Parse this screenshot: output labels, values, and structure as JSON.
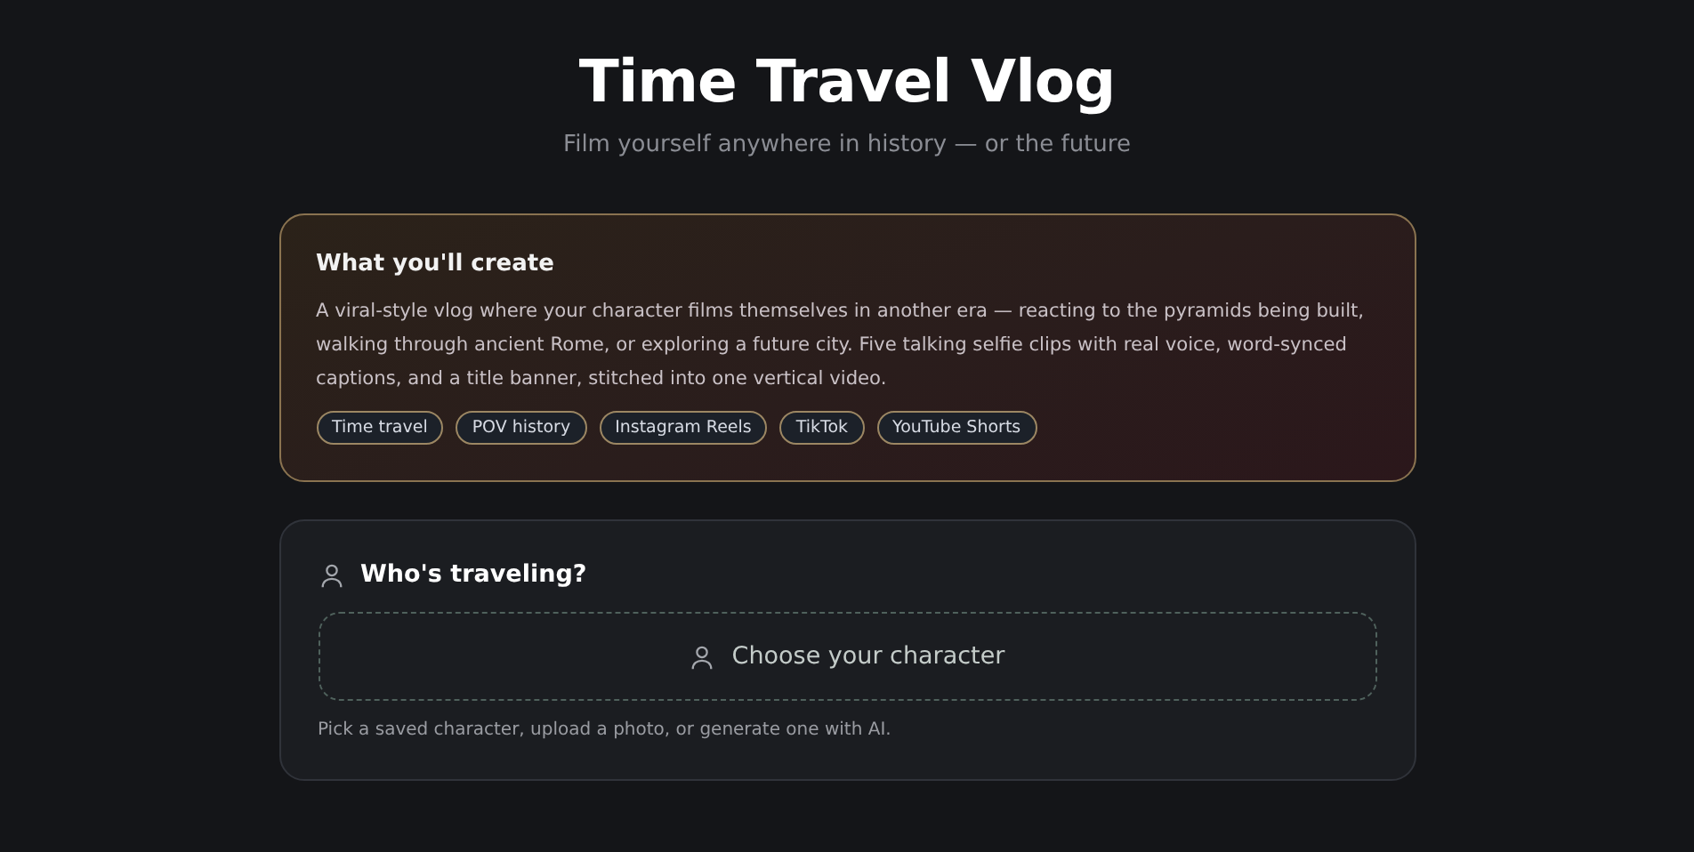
{
  "header": {
    "title": "Time Travel Vlog",
    "subtitle": "Film yourself anywhere in history — or the future"
  },
  "intro_card": {
    "title": "What you'll create",
    "description": "A viral-style vlog where your character films themselves in another era — reacting to the pyramids being built, walking through ancient Rome, or exploring a future city. Five talking selfie clips with real voice, word-synced captions, and a title banner, stitched into one vertical video.",
    "tags": [
      "Time travel",
      "POV history",
      "Instagram Reels",
      "TikTok",
      "YouTube Shorts"
    ]
  },
  "character_card": {
    "title": "Who's traveling?",
    "picker_label": "Choose your character",
    "hint": "Pick a saved character, upload a photo, or generate one with AI."
  }
}
